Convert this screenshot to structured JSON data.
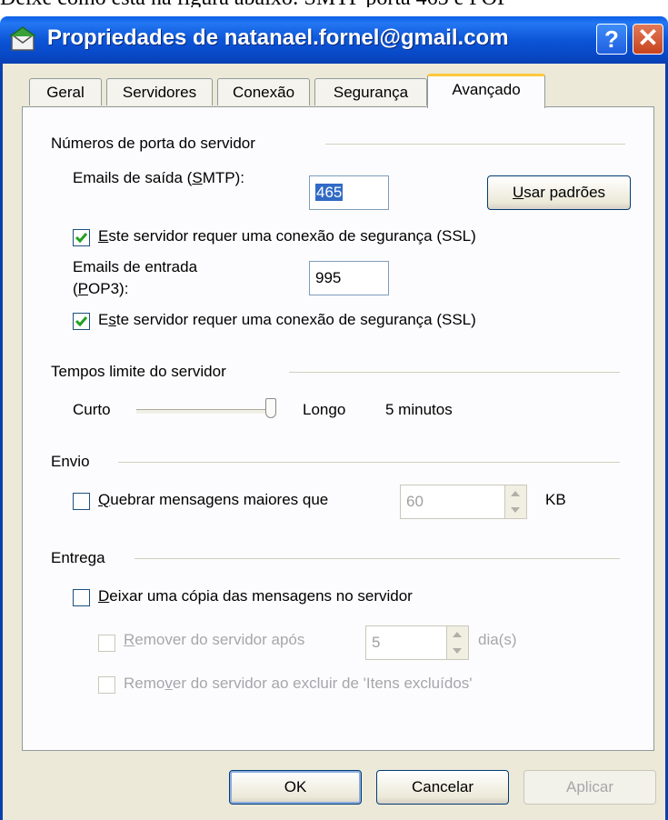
{
  "top_caption": "Deixe como está na figura abaixo: SMTP porta 465 e POP",
  "window": {
    "title": "Propriedades de natanael.fornel@gmail.com",
    "help_label": "?",
    "close_label": "✕"
  },
  "tabs": [
    {
      "label": "Geral",
      "active": false
    },
    {
      "label": "Servidores",
      "active": false
    },
    {
      "label": "Conexão",
      "active": false
    },
    {
      "label": "Segurança",
      "active": false
    },
    {
      "label": "Avançado",
      "active": true
    }
  ],
  "ports": {
    "group_label": "Números de porta do servidor",
    "smtp_label": "Emails de saída (SMTP):",
    "smtp_value": "465",
    "use_defaults_label": "Usar padrões",
    "smtp_ssl": {
      "label": "Este servidor requer uma conexão de segurança (SSL)",
      "checked": true
    },
    "pop3_label_line1": "Emails de entrada",
    "pop3_label_line2": "(POP3):",
    "pop3_value": "995",
    "pop3_ssl": {
      "label": "Este servidor requer uma conexão de segurança (SSL)",
      "checked": true
    }
  },
  "timeouts": {
    "group_label": "Tempos limite do servidor",
    "short_label": "Curto",
    "long_label": "Longo",
    "value_text": "5 minutos",
    "slider_fraction": 1.0
  },
  "sending": {
    "group_label": "Envio",
    "break_label": "Quebrar mensagens maiores que",
    "break_checked": false,
    "size_value": "60",
    "size_unit": "KB"
  },
  "delivery": {
    "group_label": "Entrega",
    "leave_copy_label": "Deixar uma cópia das mensagens no servidor",
    "leave_copy_checked": false,
    "remove_after_label": "Remover do servidor após",
    "remove_after_value": "5",
    "remove_after_unit": "dia(s)",
    "remove_on_delete_label": "Remover do servidor ao excluir de 'Itens excluídos'"
  },
  "buttons": {
    "ok": "OK",
    "cancel": "Cancelar",
    "apply": "Aplicar"
  },
  "colors": {
    "titlebar": "#0a55d8",
    "dialog_bg": "#ece9d8",
    "active_tab_accent": "#ffc83c",
    "check_green": "#21a121"
  }
}
